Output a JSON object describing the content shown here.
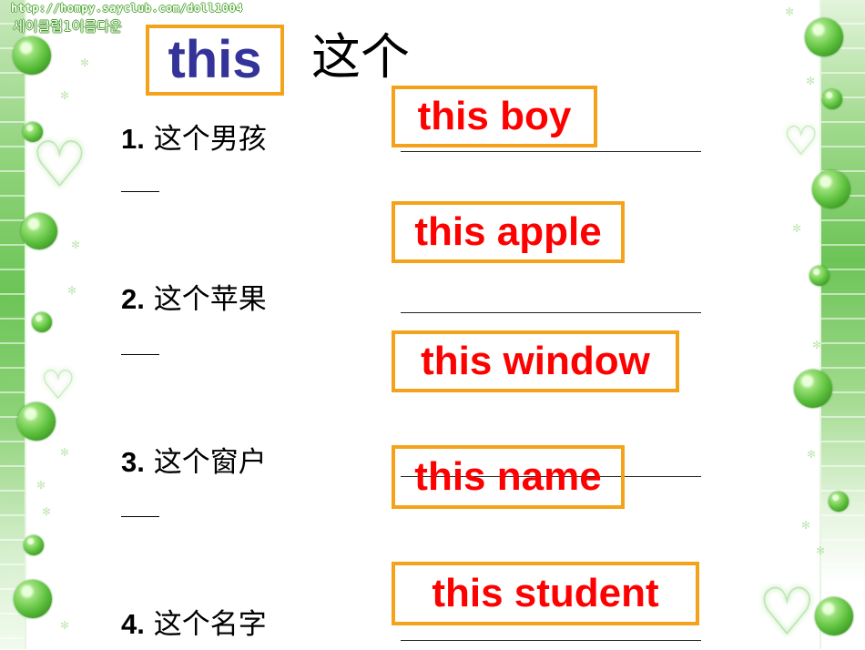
{
  "watermark": {
    "url": "http://hompy.sayclub.com/doll1004",
    "korean": "세이클럽1이름다운"
  },
  "title": {
    "word": "this",
    "translation": "这个"
  },
  "questions": [
    {
      "number": "1.",
      "chinese": "这个男孩",
      "answer": "this boy"
    },
    {
      "number": "2.",
      "chinese": "这个苹果",
      "answer": "this apple"
    },
    {
      "number": "3.",
      "chinese": "这个窗户",
      "answer": "this window"
    },
    {
      "number": "4.",
      "chinese": "这个名字",
      "answer": "this name"
    }
  ],
  "extra_answer": "this student",
  "colors": {
    "title_word": "#333399",
    "answer_text": "#ff0000",
    "box_border": "#f5a21b",
    "decor_green": "#6cc456"
  },
  "icons": {
    "heart": "♡",
    "sparkle": "✻"
  }
}
